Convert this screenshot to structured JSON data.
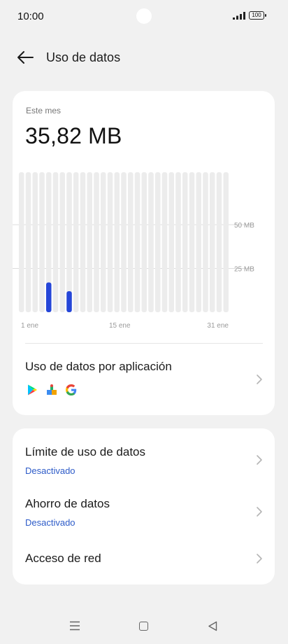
{
  "status": {
    "time": "10:00",
    "battery": "100"
  },
  "header": {
    "title": "Uso de datos"
  },
  "usage": {
    "period_label": "Este mes",
    "total": "35,82 MB"
  },
  "chart_data": {
    "type": "bar",
    "categories": [
      "1",
      "2",
      "3",
      "4",
      "5",
      "6",
      "7",
      "8",
      "9",
      "10",
      "11",
      "12",
      "13",
      "14",
      "15",
      "16",
      "17",
      "18",
      "19",
      "20",
      "21",
      "22",
      "23",
      "24",
      "25",
      "26",
      "27",
      "28",
      "29",
      "30",
      "31"
    ],
    "values": [
      0,
      0,
      0,
      0,
      17,
      0,
      0,
      12,
      0,
      0,
      0,
      0,
      0,
      0,
      0,
      0,
      0,
      0,
      0,
      0,
      0,
      0,
      0,
      0,
      0,
      0,
      0,
      0,
      0,
      0,
      0
    ],
    "x_tick_labels": [
      "1 ene",
      "15 ene",
      "31 ene"
    ],
    "y_tick_labels": [
      "50 MB",
      "25 MB"
    ],
    "y_ticks": [
      50,
      25
    ],
    "ylim": [
      0,
      80
    ],
    "colors": {
      "bar": "#2546d8",
      "track": "#ececec",
      "grid": "#dcdcdc"
    }
  },
  "app_usage": {
    "label": "Uso de datos por aplicación",
    "icons": [
      "google-play-icon",
      "puzzle-app-icon",
      "google-icon"
    ]
  },
  "settings": [
    {
      "title": "Límite de uso de datos",
      "subtitle": "Desactivado"
    },
    {
      "title": "Ahorro de datos",
      "subtitle": "Desactivado"
    },
    {
      "title": "Acceso de red",
      "subtitle": ""
    }
  ],
  "colors": {
    "accent": "#2d5bc8",
    "background": "#f1f1f1",
    "card": "#ffffff"
  }
}
